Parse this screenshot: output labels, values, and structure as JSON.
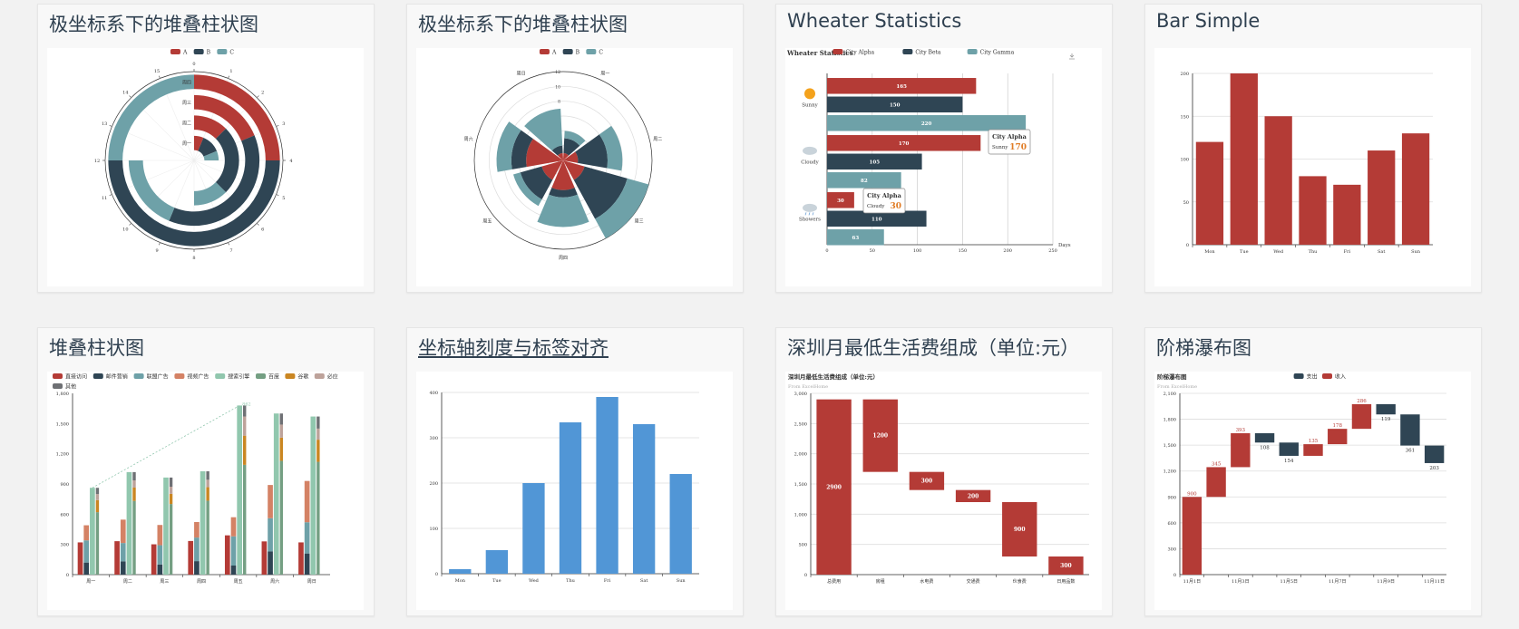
{
  "cards": [
    {
      "title": "极坐标系下的堆叠柱状图"
    },
    {
      "title": "极坐标系下的堆叠柱状图"
    },
    {
      "title": "Wheater Statistics"
    },
    {
      "title": "Bar Simple"
    },
    {
      "title": "堆叠柱状图"
    },
    {
      "title": "坐标轴刻度与标签对齐"
    },
    {
      "title": "深圳月最低生活费组成（单位:元）"
    },
    {
      "title": "阶梯瀑布图"
    }
  ],
  "colors": {
    "red": "#b43b36",
    "navy": "#2f4554",
    "teal": "#6ea1a8",
    "blue": "#5196d6",
    "grid": "#dddddd",
    "axis": "#333333"
  },
  "chart_data": [
    {
      "type": "bar",
      "polar": "radial",
      "legend": [
        "A",
        "B",
        "C"
      ],
      "legend_position": "top",
      "categories": [
        "周一",
        "周二",
        "周三",
        "周四"
      ],
      "angle_axis": {
        "min": 0,
        "max": 16,
        "ticks": [
          "0",
          "1",
          "2",
          "3",
          "4",
          "5",
          "6",
          "7",
          "8",
          "9",
          "10",
          "11",
          "12",
          "13",
          "14",
          "15"
        ]
      },
      "series": [
        {
          "name": "A",
          "values": [
            1,
            2,
            3,
            4
          ]
        },
        {
          "name": "B",
          "values": [
            2,
            4,
            6,
            8
          ]
        },
        {
          "name": "C",
          "values": [
            1,
            2,
            3,
            4
          ]
        }
      ]
    },
    {
      "type": "bar",
      "polar": "angular",
      "legend": [
        "A",
        "B",
        "C"
      ],
      "legend_position": "top",
      "categories": [
        "周一",
        "周二",
        "周三",
        "周四",
        "周五",
        "周六",
        "周日"
      ],
      "radius_ticks": [
        "0",
        "2",
        "4",
        "6",
        "8",
        "10",
        "12"
      ],
      "series": [
        {
          "name": "A",
          "values": [
            1,
            2,
            3,
            4,
            3,
            5,
            1
          ]
        },
        {
          "name": "B",
          "values": [
            2,
            4,
            6,
            1,
            3,
            2,
            1
          ]
        },
        {
          "name": "C",
          "values": [
            1,
            2,
            3,
            4,
            1,
            2,
            5
          ]
        }
      ]
    },
    {
      "type": "bar",
      "orientation": "horizontal",
      "title": "Wheater Statistics",
      "legend": [
        "City Alpha",
        "City Beta",
        "City Gamma"
      ],
      "categories": [
        "Sunny",
        "Cloudy",
        "Showers"
      ],
      "x_ticks": [
        "0",
        "50",
        "100",
        "150",
        "200",
        "250"
      ],
      "xlim": [
        0,
        250
      ],
      "xlabel": "Days",
      "series": [
        {
          "name": "City Alpha",
          "values": [
            165,
            170,
            30
          ]
        },
        {
          "name": "City Beta",
          "values": [
            150,
            105,
            110
          ]
        },
        {
          "name": "City Gamma",
          "values": [
            220,
            82,
            63
          ]
        }
      ],
      "tooltips": [
        {
          "name": "City Alpha",
          "label": "Sunny",
          "value": "170"
        },
        {
          "name": "City Alpha",
          "label": "Cloudy",
          "value": "30"
        }
      ]
    },
    {
      "type": "bar",
      "categories": [
        "Mon",
        "Tue",
        "Wed",
        "Thu",
        "Fri",
        "Sat",
        "Sun"
      ],
      "values": [
        120,
        200,
        150,
        80,
        70,
        110,
        130
      ],
      "y_ticks": [
        "0",
        "50",
        "100",
        "150",
        "200"
      ],
      "ylim": [
        0,
        200
      ],
      "grid": true
    },
    {
      "type": "bar",
      "stacked": true,
      "legend": [
        "直接访问",
        "邮件营销",
        "联盟广告",
        "视频广告",
        "搜索引擎",
        "百度",
        "谷歌",
        "必应",
        "其他"
      ],
      "categories": [
        "周一",
        "周二",
        "周三",
        "周四",
        "周五",
        "周六",
        "周日"
      ],
      "y_ticks": [
        "0",
        "300",
        "600",
        "900",
        "1,200",
        "1,500",
        "1,800"
      ],
      "ylim": [
        0,
        1800
      ],
      "series": [
        {
          "name": "直接访问",
          "values": [
            320,
            332,
            301,
            334,
            390,
            330,
            320
          ]
        },
        {
          "name": "邮件营销",
          "values": [
            120,
            132,
            101,
            134,
            90,
            230,
            210
          ]
        },
        {
          "name": "联盟广告",
          "values": [
            220,
            182,
            191,
            234,
            290,
            330,
            310
          ]
        },
        {
          "name": "视频广告",
          "values": [
            150,
            232,
            201,
            154,
            190,
            330,
            410
          ]
        },
        {
          "name": "搜索引擎",
          "values": [
            862,
            1018,
            964,
            1026,
            1679,
            1600,
            1570
          ]
        },
        {
          "name": "百度",
          "values": [
            620,
            732,
            701,
            734,
            1090,
            1130,
            1120
          ]
        },
        {
          "name": "谷歌",
          "values": [
            120,
            132,
            101,
            134,
            290,
            230,
            220
          ]
        },
        {
          "name": "必应",
          "values": [
            60,
            72,
            71,
            74,
            190,
            130,
            110
          ]
        },
        {
          "name": "其他",
          "values": [
            62,
            82,
            91,
            84,
            109,
            110,
            120
          ]
        }
      ],
      "markline_label": "862"
    },
    {
      "type": "bar",
      "categories": [
        "Mon",
        "Tue",
        "Wed",
        "Thu",
        "Fri",
        "Sat",
        "Sun"
      ],
      "values": [
        10,
        52,
        200,
        334,
        390,
        330,
        220
      ],
      "y_ticks": [
        "0",
        "100",
        "200",
        "300",
        "400"
      ],
      "ylim": [
        0,
        400
      ],
      "grid": true
    },
    {
      "type": "bar",
      "waterfall": true,
      "title": "深圳月最低生活费组成（单位:元）",
      "subtitle": "From ExcelHome",
      "categories": [
        "总费用",
        "房租",
        "水电费",
        "交通费",
        "伙食费",
        "日用品数"
      ],
      "values": [
        2900,
        1200,
        300,
        200,
        900,
        300
      ],
      "bases": [
        0,
        1700,
        1400,
        1200,
        300,
        0
      ],
      "y_ticks": [
        "0",
        "500",
        "1,000",
        "1,500",
        "2,000",
        "2,500",
        "3,000"
      ],
      "ylim": [
        0,
        3000
      ]
    },
    {
      "type": "bar",
      "waterfall": true,
      "title": "阶梯瀑布图",
      "subtitle": "From ExcelHome",
      "legend": [
        "支出",
        "收入"
      ],
      "categories": [
        "11月1日",
        "11月2日",
        "11月3日",
        "11月4日",
        "11月5日",
        "11月6日",
        "11月7日",
        "11月8日",
        "11月9日",
        "11月10日",
        "11月11日"
      ],
      "x_ticks": [
        "11月1日",
        "11月3日",
        "11月5日",
        "11月7日",
        "11月9日",
        "11月11日"
      ],
      "y_ticks": [
        "0",
        "300",
        "600",
        "900",
        "1,200",
        "1,500",
        "1,800",
        "2,100"
      ],
      "ylim": [
        0,
        2100
      ],
      "income": [
        900,
        345,
        393,
        "-",
        "-",
        135,
        178,
        286,
        "-",
        "-",
        "-"
      ],
      "expense": [
        "-",
        "-",
        "-",
        108,
        154,
        "-",
        "-",
        "-",
        119,
        361,
        203
      ]
    }
  ]
}
